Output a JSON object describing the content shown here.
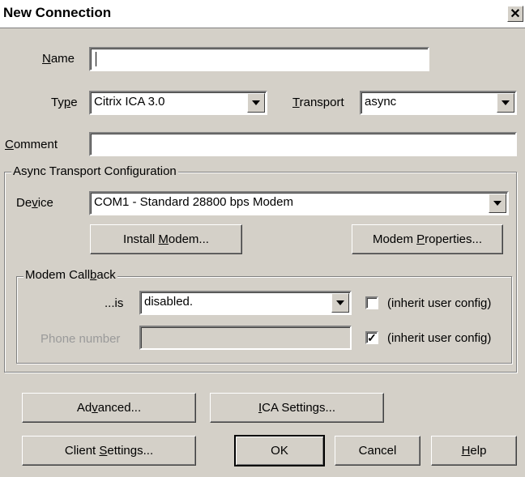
{
  "window": {
    "title": "New Connection",
    "close_glyph": "✕"
  },
  "labels": {
    "name_pre": "",
    "name_u": "N",
    "name_post": "ame",
    "type_pre": "Ty",
    "type_u": "p",
    "type_post": "e",
    "transport_pre": "",
    "transport_u": "T",
    "transport_post": "ransport",
    "comment_pre": "",
    "comment_u": "C",
    "comment_post": "omment",
    "device_pre": "De",
    "device_u": "v",
    "device_post": "ice",
    "is": "...is",
    "phone": "Phone number"
  },
  "fields": {
    "name": "",
    "type": "Citrix ICA 3.0",
    "transport": "async",
    "comment": "",
    "device": "COM1 - Standard 28800 bps Modem",
    "callback": "disabled.",
    "phone": ""
  },
  "groups": {
    "async": "Async Transport Configuration",
    "callback_pre": "Modem Call",
    "callback_u": "b",
    "callback_post": "ack"
  },
  "checkboxes": {
    "inherit1": {
      "label": "(inherit user config)",
      "checked": false,
      "mark": ""
    },
    "inherit2": {
      "label": "(inherit user config)",
      "checked": true,
      "mark": "✓"
    }
  },
  "buttons": {
    "install_pre": "Install ",
    "install_u": "M",
    "install_post": "odem...",
    "props_pre": "Modem ",
    "props_u": "P",
    "props_post": "roperties...",
    "advanced_pre": "Ad",
    "advanced_u": "v",
    "advanced_post": "anced...",
    "ica_pre": "",
    "ica_u": "I",
    "ica_post": "CA Settings...",
    "client_pre": "Client ",
    "client_u": "S",
    "client_post": "ettings...",
    "ok": "OK",
    "cancel": "Cancel",
    "help_pre": "",
    "help_u": "H",
    "help_post": "elp"
  }
}
